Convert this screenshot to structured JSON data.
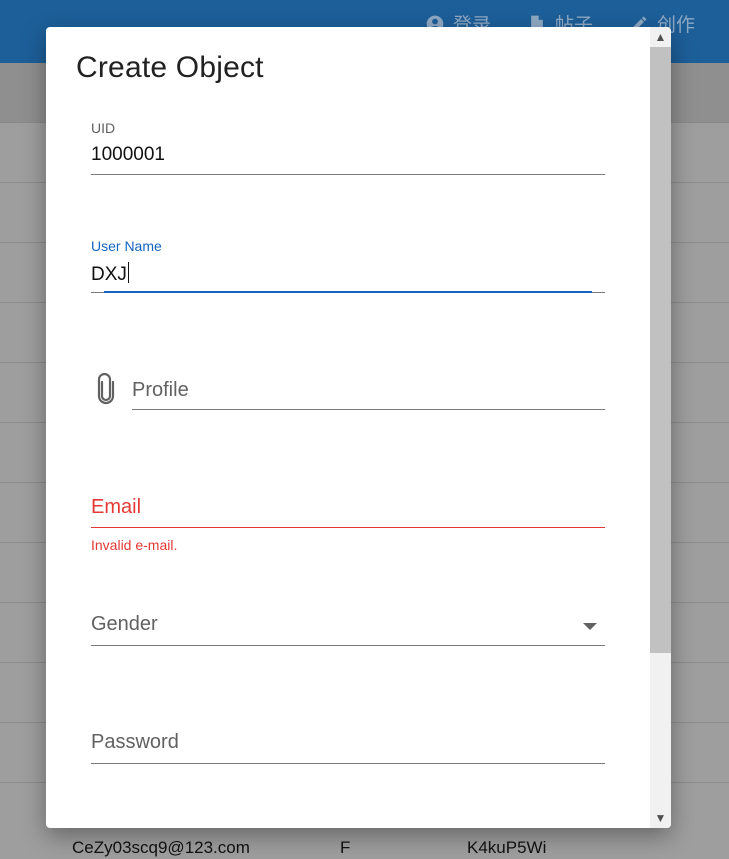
{
  "app": {
    "nav": [
      {
        "label": "登录",
        "icon": "account-circle-icon"
      },
      {
        "label": "帖子",
        "icon": "document-icon"
      },
      {
        "label": "创作",
        "icon": "pencil-icon"
      }
    ],
    "background_row": {
      "email": "CeZy03scq9@123.com",
      "gender": "F",
      "password": "K4kuP5Wi"
    }
  },
  "dialog": {
    "title": "Create Object",
    "fields": {
      "uid": {
        "label": "UID",
        "value": "1000001"
      },
      "user_name": {
        "label": "User Name",
        "value": "DXJ"
      },
      "profile": {
        "placeholder": "Profile",
        "icon": "paperclip-icon"
      },
      "email": {
        "placeholder": "Email",
        "error": "Invalid e-mail."
      },
      "gender": {
        "placeholder": "Gender",
        "icon": "dropdown-arrow-icon"
      },
      "password": {
        "placeholder": "Password"
      }
    }
  },
  "colors": {
    "appbar": "#1d5f99",
    "accent": "#1565c0",
    "error": "#e53935"
  }
}
